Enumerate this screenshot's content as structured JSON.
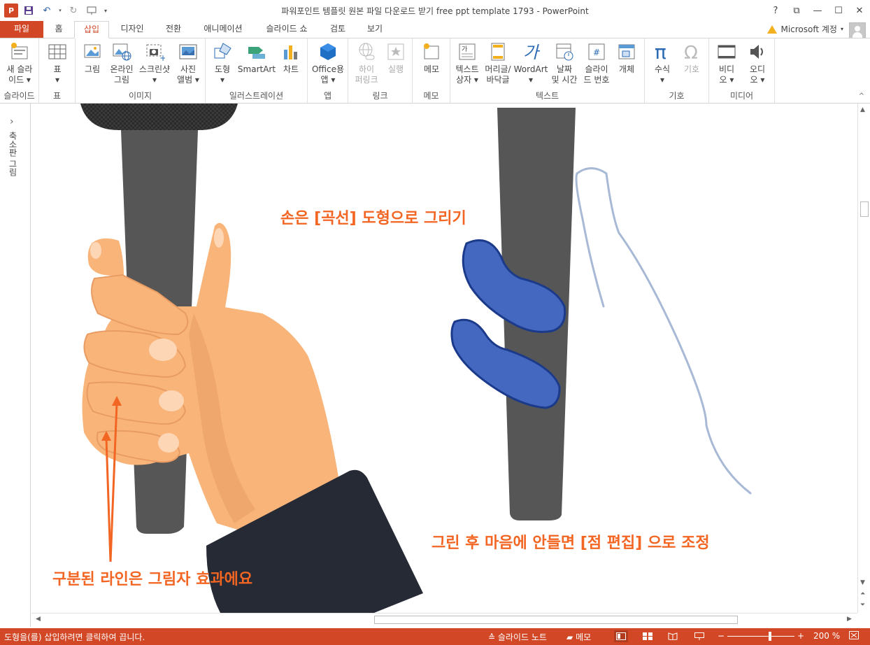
{
  "window": {
    "title": "파워포인트 템플릿 원본 파일 다운로드 받기 free ppt template 1793 - PowerPoint",
    "controls": [
      "?",
      "⧉",
      "—",
      "☐",
      "✕"
    ]
  },
  "tabs": {
    "file": "파일",
    "items": [
      "홈",
      "삽입",
      "디자인",
      "전환",
      "애니메이션",
      "슬라이드 쇼",
      "검토",
      "보기"
    ],
    "active": "삽입"
  },
  "account": {
    "label": "Microsoft 계정"
  },
  "ribbon": {
    "groups": [
      {
        "label": "슬라이드",
        "buttons": [
          {
            "label": "새 슬라\n이드 ▾",
            "icon": "new-slide-icon"
          }
        ]
      },
      {
        "label": "표",
        "buttons": [
          {
            "label": "표\n▾",
            "icon": "table-icon"
          }
        ]
      },
      {
        "label": "이미지",
        "buttons": [
          {
            "label": "그림",
            "icon": "picture-icon"
          },
          {
            "label": "온라인\n그림",
            "icon": "online-picture-icon"
          },
          {
            "label": "스크린샷\n▾",
            "icon": "screenshot-icon"
          },
          {
            "label": "사진\n앨범 ▾",
            "icon": "photo-album-icon"
          }
        ]
      },
      {
        "label": "일러스트레이션",
        "buttons": [
          {
            "label": "도형\n▾",
            "icon": "shapes-icon"
          },
          {
            "label": "SmartArt",
            "icon": "smartart-icon"
          },
          {
            "label": "차트",
            "icon": "chart-icon"
          }
        ]
      },
      {
        "label": "앱",
        "buttons": [
          {
            "label": "Office용\n앱 ▾",
            "icon": "office-apps-icon"
          }
        ]
      },
      {
        "label": "링크",
        "buttons": [
          {
            "label": "하이\n퍼링크",
            "icon": "hyperlink-icon",
            "disabled": true
          },
          {
            "label": "실행",
            "icon": "action-icon",
            "disabled": true
          }
        ]
      },
      {
        "label": "메모",
        "buttons": [
          {
            "label": "메모",
            "icon": "comment-icon"
          }
        ]
      },
      {
        "label": "텍스트",
        "buttons": [
          {
            "label": "텍스트\n상자 ▾",
            "icon": "textbox-icon"
          },
          {
            "label": "머리글/\n바닥글",
            "icon": "header-footer-icon"
          },
          {
            "label": "WordArt\n▾",
            "icon": "wordart-icon"
          },
          {
            "label": "날짜\n및 시간",
            "icon": "date-time-icon"
          },
          {
            "label": "슬라이\n드 번호",
            "icon": "slide-number-icon"
          },
          {
            "label": "개체",
            "icon": "object-icon"
          }
        ]
      },
      {
        "label": "기호",
        "buttons": [
          {
            "label": "수식\n▾",
            "icon": "equation-icon"
          },
          {
            "label": "기호",
            "icon": "symbol-icon",
            "disabled": true
          }
        ]
      },
      {
        "label": "미디어",
        "buttons": [
          {
            "label": "비디\n오 ▾",
            "icon": "video-icon"
          },
          {
            "label": "오디\n오 ▾",
            "icon": "audio-icon"
          }
        ]
      }
    ]
  },
  "left_panel": {
    "label": "축소판 그림"
  },
  "slide": {
    "annotations": {
      "top": "손은 [곡선] 도형으로 그리기",
      "bottom_right": "그린 후 마음에 안들면 [점 편집] 으로 조정",
      "bottom_left": "구분된 라인은 그림자 효과에요"
    },
    "colors": {
      "skin": "#f9b47a",
      "skin_shadow": "#e89c63",
      "nail": "#fdd6b5",
      "pole": "#565656",
      "sleeve": "#262a35",
      "blue_fingers": "#4468c0",
      "sketch": "#a8b9d6",
      "annotation": "#f26522"
    }
  },
  "status": {
    "message": "도형을(를) 삽입하려면 클릭하여 끕니다.",
    "notes": "슬라이드 노트",
    "comments": "메모",
    "zoom": "200 %"
  }
}
